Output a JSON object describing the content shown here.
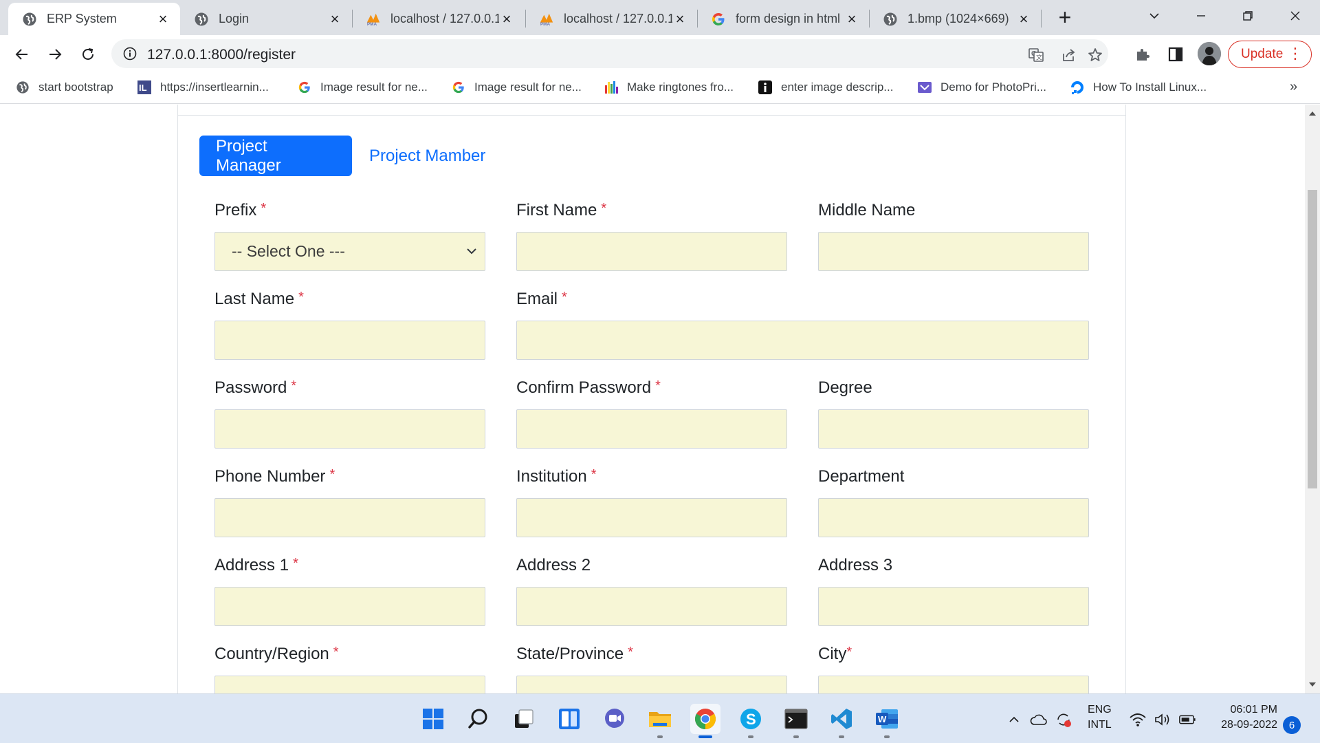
{
  "browser": {
    "tabs": [
      {
        "title": "ERP System",
        "icon": "globe-icon",
        "active": true
      },
      {
        "title": "Login",
        "icon": "globe-icon",
        "active": false
      },
      {
        "title": "localhost / 127.0.0.1",
        "icon": "phpmyadmin-icon",
        "active": false
      },
      {
        "title": "localhost / 127.0.0.1",
        "icon": "phpmyadmin-icon",
        "active": false
      },
      {
        "title": "form design in html",
        "icon": "google-icon",
        "active": false
      },
      {
        "title": "1.bmp (1024×669)",
        "icon": "globe-icon",
        "active": false
      }
    ],
    "new_tab_label": "+",
    "url": "127.0.0.1:8000/register",
    "update_label": "Update",
    "bookmarks": [
      {
        "label": "start bootstrap",
        "icon": "globe-icon"
      },
      {
        "label": "https://insertlearnin...",
        "icon": "insertlearning-icon"
      },
      {
        "label": "Image result for ne...",
        "icon": "google-icon"
      },
      {
        "label": "Image result for ne...",
        "icon": "google-icon"
      },
      {
        "label": "Make ringtones fro...",
        "icon": "ringtone-icon"
      },
      {
        "label": "enter image descrip...",
        "icon": "info-icon"
      },
      {
        "label": "Demo for PhotoPri...",
        "icon": "photoprism-icon"
      },
      {
        "label": "How To Install Linux...",
        "icon": "digitalocean-icon"
      }
    ],
    "bookmarks_more": "»"
  },
  "page": {
    "role_tabs": {
      "active": "Project Manager",
      "inactive": "Project Mamber"
    },
    "form": {
      "prefix_label": "Prefix",
      "prefix_value": "-- Select One ---",
      "first_name_label": "First Name",
      "middle_name_label": "Middle Name",
      "last_name_label": "Last Name",
      "email_label": "Email",
      "password_label": "Password",
      "confirm_password_label": "Confirm Password",
      "degree_label": "Degree",
      "phone_label": "Phone Number",
      "institution_label": "Institution",
      "department_label": "Department",
      "address1_label": "Address 1",
      "address2_label": "Address 2",
      "address3_label": "Address 3",
      "country_label": "Country/Region",
      "state_label": "State/Province",
      "city_label": "City",
      "required_mark": "*"
    },
    "colors": {
      "primary": "#0d6efd",
      "input_bg": "#f7f6d6",
      "required": "#dc3545"
    }
  },
  "taskbar": {
    "apps": [
      "windows-start-icon",
      "search-icon",
      "task-view-icon",
      "widgets-icon",
      "teams-chat-icon",
      "file-explorer-icon",
      "chrome-icon",
      "skype-icon",
      "terminal-icon",
      "vscode-icon",
      "word-icon"
    ],
    "lang_top": "ENG",
    "lang_bottom": "INTL",
    "time": "06:01 PM",
    "date": "28-09-2022",
    "notifications": "6"
  }
}
